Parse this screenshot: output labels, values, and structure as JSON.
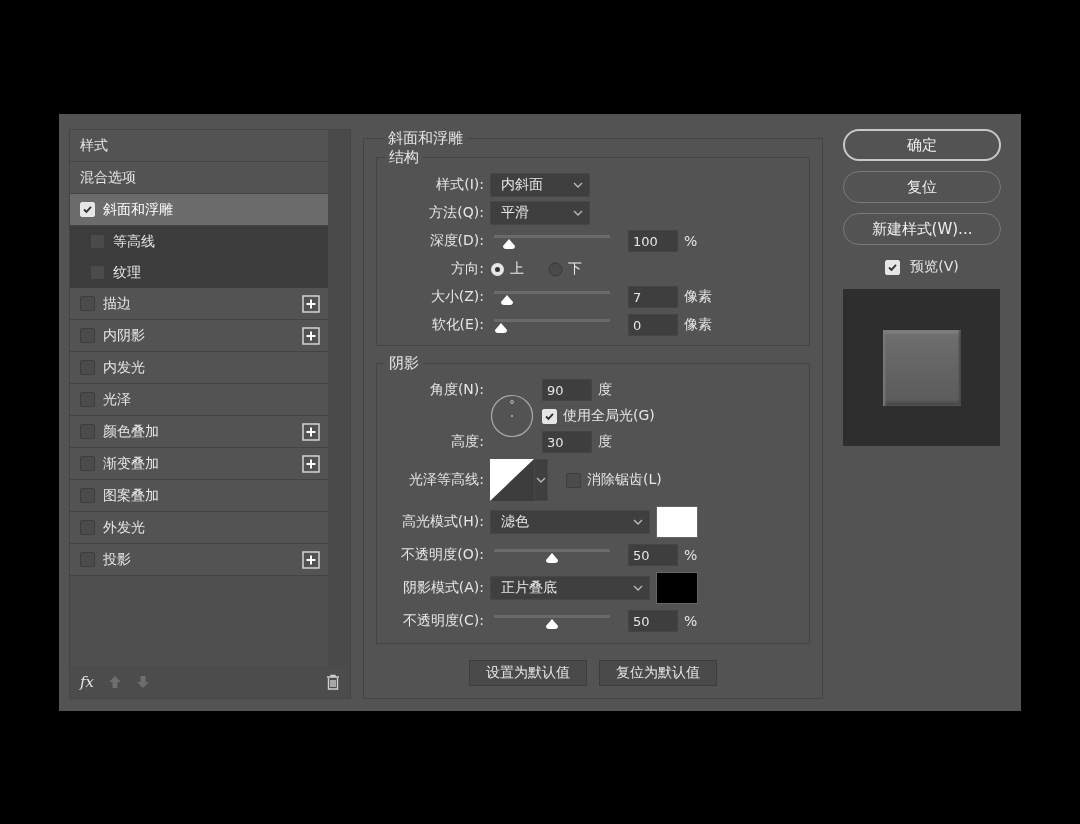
{
  "styles_panel": {
    "title": "样式",
    "items": [
      {
        "kind": "option",
        "label": "混合选项",
        "selected": false
      },
      {
        "kind": "effect",
        "label": "斜面和浮雕",
        "checked": true,
        "selected": true,
        "add_button": false,
        "children": [
          {
            "label": "等高线",
            "checked": false
          },
          {
            "label": "纹理",
            "checked": false
          }
        ]
      },
      {
        "kind": "effect",
        "label": "描边",
        "checked": false,
        "selected": false,
        "add_button": true
      },
      {
        "kind": "effect",
        "label": "内阴影",
        "checked": false,
        "selected": false,
        "add_button": true
      },
      {
        "kind": "effect",
        "label": "内发光",
        "checked": false,
        "selected": false,
        "add_button": false
      },
      {
        "kind": "effect",
        "label": "光泽",
        "checked": false,
        "selected": false,
        "add_button": false
      },
      {
        "kind": "effect",
        "label": "颜色叠加",
        "checked": false,
        "selected": false,
        "add_button": true
      },
      {
        "kind": "effect",
        "label": "渐变叠加",
        "checked": false,
        "selected": false,
        "add_button": true
      },
      {
        "kind": "effect",
        "label": "图案叠加",
        "checked": false,
        "selected": false,
        "add_button": false
      },
      {
        "kind": "effect",
        "label": "外发光",
        "checked": false,
        "selected": false,
        "add_button": false
      },
      {
        "kind": "effect",
        "label": "投影",
        "checked": false,
        "selected": false,
        "add_button": true
      }
    ],
    "footer": {
      "fx": "fx"
    }
  },
  "bevel_emboss": {
    "title": "斜面和浮雕",
    "structure": {
      "title": "结构",
      "style": {
        "label": "样式(I):",
        "value": "内斜面"
      },
      "technique": {
        "label": "方法(Q):",
        "value": "平滑"
      },
      "depth": {
        "label": "深度(D):",
        "level": 0.08,
        "value": "100",
        "unit": "%"
      },
      "direction": {
        "label": "方向:",
        "options": [
          {
            "label": "上",
            "selected": true
          },
          {
            "label": "下",
            "selected": false
          }
        ]
      },
      "size": {
        "label": "大小(Z):",
        "level": 0.06,
        "value": "7",
        "unit": "像素"
      },
      "soften": {
        "label": "软化(E):",
        "level": 0,
        "value": "0",
        "unit": "像素"
      }
    },
    "shading": {
      "title": "阴影",
      "angle": {
        "label": "角度(N):",
        "value": "90",
        "unit": "度"
      },
      "global_light": {
        "label": "使用全局光(G)",
        "checked": true
      },
      "altitude": {
        "label": "高度:",
        "value": "30",
        "unit": "度"
      },
      "gloss_contour": {
        "label": "光泽等高线:"
      },
      "anti_alias": {
        "label": "消除锯齿(L)",
        "checked": false
      },
      "highlight_mode": {
        "label": "高光模式(H):",
        "value": "滤色",
        "color": "#ffffff"
      },
      "highlight_opacity": {
        "label": "不透明度(O):",
        "level": 0.5,
        "value": "50",
        "unit": "%"
      },
      "shadow_mode": {
        "label": "阴影模式(A):",
        "value": "正片叠底",
        "color": "#000000"
      },
      "shadow_opacity": {
        "label": "不透明度(C):",
        "level": 0.5,
        "value": "50",
        "unit": "%"
      }
    },
    "buttons": [
      "设置为默认值",
      "复位为默认值"
    ]
  },
  "actions": [
    {
      "label": "确定",
      "kind": "primary"
    },
    {
      "label": "复位",
      "kind": "normal"
    },
    {
      "label": "新建样式(W)...",
      "kind": "normal"
    }
  ],
  "preview": {
    "label": "预览(V)",
    "checked": true
  }
}
